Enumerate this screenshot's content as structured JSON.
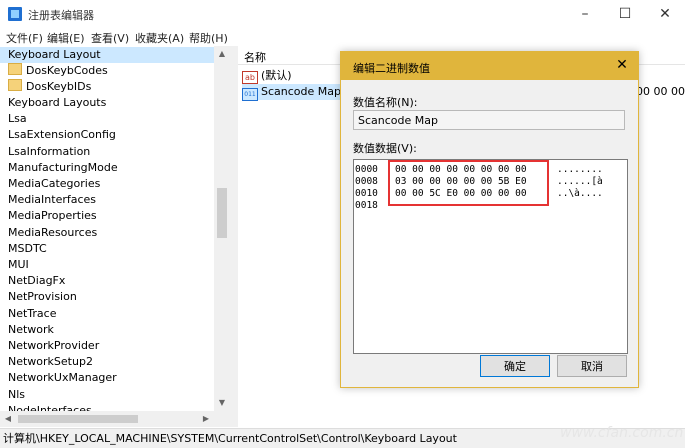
{
  "window": {
    "title": "注册表编辑器",
    "controls": [
      "–",
      "☐",
      "✕"
    ]
  },
  "menu": [
    "文件(F)",
    "编辑(E)",
    "查看(V)",
    "收藏夹(A)",
    "帮助(H)"
  ],
  "tree": {
    "selected": "Keyboard Layout",
    "children": [
      "DosKeybCodes",
      "DosKeybIDs"
    ],
    "siblings": [
      "Keyboard Layouts",
      "Lsa",
      "LsaExtensionConfig",
      "LsaInformation",
      "ManufacturingMode",
      "MediaCategories",
      "MediaInterfaces",
      "MediaProperties",
      "MediaResources",
      "MSDTC",
      "MUI",
      "NetDiagFx",
      "NetProvision",
      "NetTrace",
      "Network",
      "NetworkProvider",
      "NetworkSetup2",
      "NetworkUxManager",
      "Nls",
      "NodeInterfaces"
    ]
  },
  "list": {
    "header_name": "名称",
    "rows": [
      {
        "icon": "ab",
        "name": "(默认)"
      },
      {
        "icon": "bin",
        "name": "Scancode Map"
      }
    ],
    "data_fragment": "00 00 00 0"
  },
  "dialog": {
    "title": "编辑二进制数值",
    "value_name_label": "数值名称(N):",
    "value_name": "Scancode Map",
    "value_data_label": "数值数据(V):",
    "rows": [
      {
        "offset": "0000",
        "bytes": "00 00 00 00 00 00 00 00",
        "ascii": "........"
      },
      {
        "offset": "0008",
        "bytes": "03 00 00 00 00 00 5B E0",
        "ascii": "......[à"
      },
      {
        "offset": "0010",
        "bytes": "00 00 5C E0 00 00 00 00",
        "ascii": "..\\à...."
      },
      {
        "offset": "0018",
        "bytes": "",
        "ascii": ""
      }
    ],
    "ok_label": "确定",
    "cancel_label": "取消"
  },
  "status": "计算机\\HKEY_LOCAL_MACHINE\\SYSTEM\\CurrentControlSet\\Control\\Keyboard Layout",
  "watermark": "www.cfan.com.cn",
  "colors": {
    "dialog_accent": "#e0b53c",
    "highlight": "#e53333",
    "selection": "#cce8ff"
  }
}
